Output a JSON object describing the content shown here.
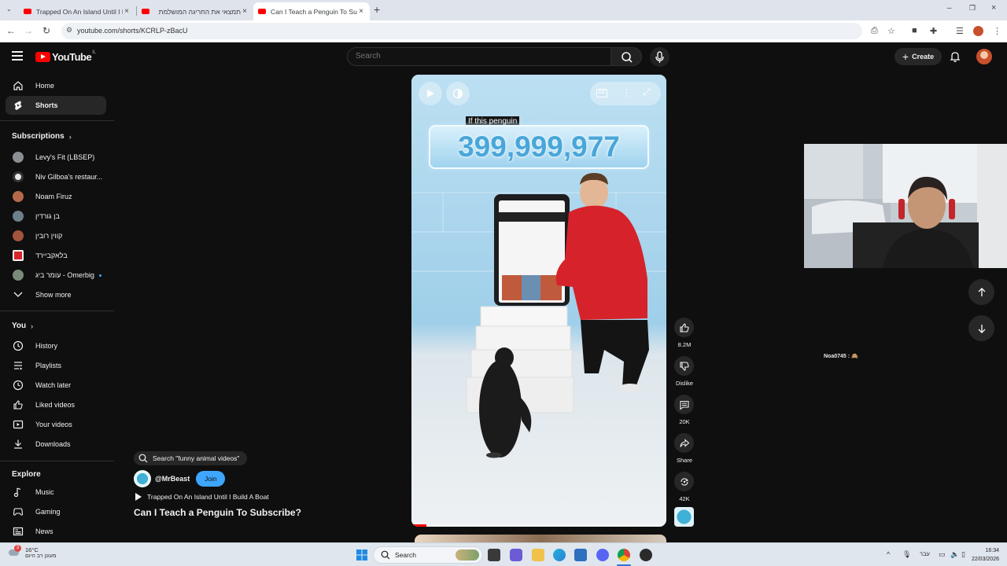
{
  "browser": {
    "tabs": [
      {
        "title": "Trapped On An Island Until I Bu"
      },
      {
        "title": "תמצאי את החריגה המושלמת"
      },
      {
        "title": "Can I Teach a Penguin To Subscr"
      }
    ],
    "url": "youtube.com/shorts/KCRLP-zBacU"
  },
  "header": {
    "logo_text": "YouTube",
    "country_code": "IL",
    "search_placeholder": "Search",
    "create_label": "Create"
  },
  "sidebar": {
    "main": [
      {
        "label": "Home",
        "icon": "home-icon"
      },
      {
        "label": "Shorts",
        "icon": "shorts-icon",
        "active": true
      }
    ],
    "subscriptions_heading": "Subscriptions",
    "subscriptions": [
      {
        "label": "Levy's Fit (LBSEP)",
        "color": "#8b8f94"
      },
      {
        "label": "Niv Gilboa's restaur...",
        "color": "#e8e8e8"
      },
      {
        "label": "Noam Firuz",
        "color": "#b46a4a"
      },
      {
        "label": "בן גורדין",
        "color": "#6e7f8c"
      },
      {
        "label": "קווין רובין",
        "color": "#a2553c"
      },
      {
        "label": "בלאקביירד",
        "color": "#d6262b"
      },
      {
        "label": "עומר ביג - Omerbig",
        "color": "#7a8a7a"
      }
    ],
    "show_more": "Show more",
    "you_heading": "You",
    "you_items": [
      {
        "label": "History",
        "icon": "history-icon"
      },
      {
        "label": "Playlists",
        "icon": "playlists-icon"
      },
      {
        "label": "Watch later",
        "icon": "watch-later-icon"
      },
      {
        "label": "Liked videos",
        "icon": "thumbs-up-icon"
      },
      {
        "label": "Your videos",
        "icon": "your-videos-icon"
      },
      {
        "label": "Downloads",
        "icon": "download-icon"
      }
    ],
    "explore_heading": "Explore",
    "explore_items": [
      {
        "label": "Music",
        "icon": "music-icon"
      },
      {
        "label": "Gaming",
        "icon": "gaming-icon"
      },
      {
        "label": "News",
        "icon": "news-icon"
      }
    ]
  },
  "video": {
    "caption": "If this penguin",
    "counter": "399,999,977",
    "progress": 0.06,
    "search_suggestion": "Search \"funny animal videos\"",
    "channel": "@MrBeast",
    "join_label": "Join",
    "related": "Trapped On An Island Until I Build A Boat",
    "title": "Can I Teach a Penguin To Subscribe?"
  },
  "actions": {
    "likes": "8.2M",
    "dislike": "Dislike",
    "comments": "20K",
    "share": "Share",
    "remix": "42K"
  },
  "overlay": {
    "chat_message": "Noa0745 : 🙈"
  },
  "taskbar": {
    "temperature": "16°C",
    "weather_condition": "מעונן רב היום",
    "weather_badge": "3",
    "search_label": "Search",
    "language": "עבר",
    "time": "16:34",
    "date": "22/03/2026"
  }
}
